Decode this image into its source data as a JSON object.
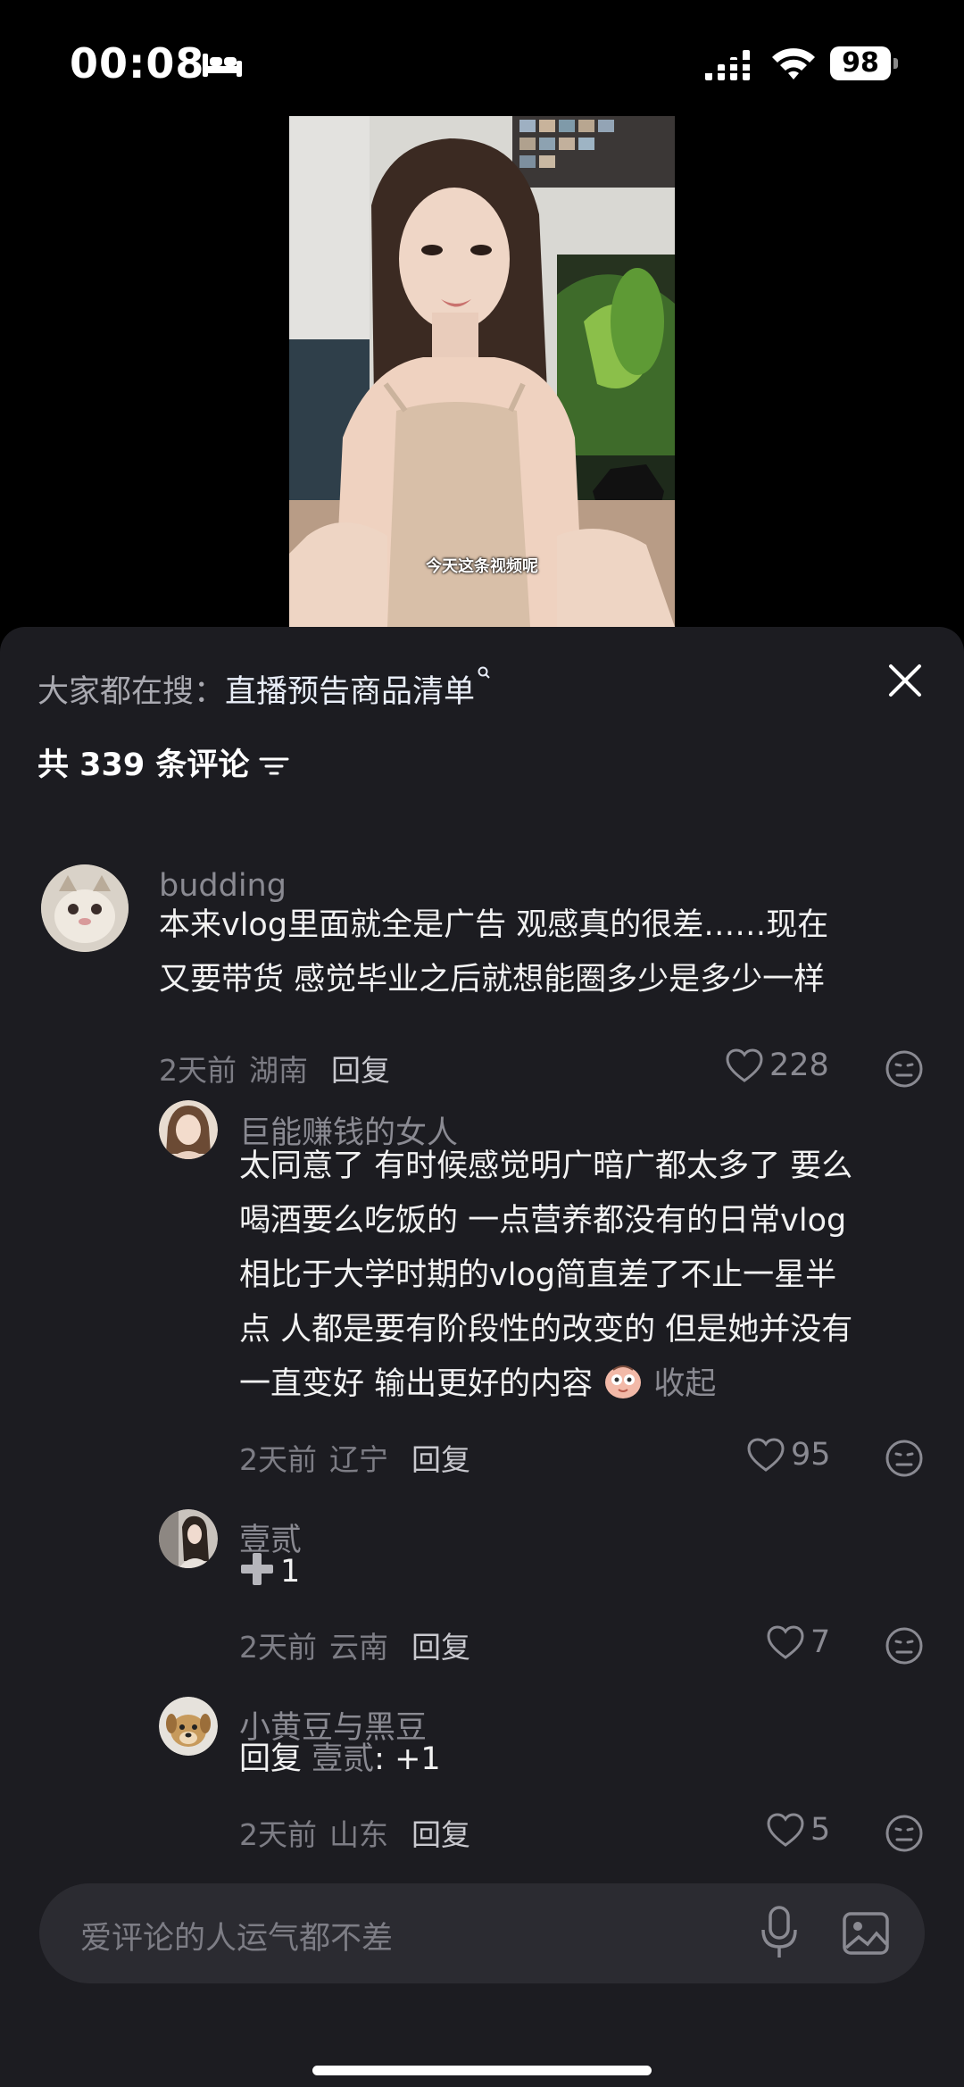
{
  "status_bar": {
    "time": "00:08",
    "battery": "98"
  },
  "video": {
    "subtitle": "今天这条视频呢"
  },
  "sheet": {
    "search_prefix": "大家都在搜：",
    "search_keyword": "直播预告商品清单",
    "count_text": "共 339 条评论"
  },
  "comments": [
    {
      "user": "budding",
      "lines": [
        "本来vlog里面就全是广告 观感真的很差……现在",
        "又要带货 感觉毕业之后就想能圈多少是多少一样"
      ],
      "time": "2天前",
      "location": "湖南",
      "reply_label": "回复",
      "likes": "228"
    },
    {
      "user": "巨能赚钱的女人",
      "lines": [
        "太同意了 有时候感觉明广暗广都太多了 要么",
        "喝酒要么吃饭的 一点营养都没有的日常vlog",
        "相比于大学时期的vlog简直差了不止一星半",
        "点 人都是要有阶段性的改变的 但是她并没有",
        "一直变好 输出更好的内容"
      ],
      "collapse_label": "收起",
      "time": "2天前",
      "location": "辽宁",
      "reply_label": "回复",
      "likes": "95"
    },
    {
      "user": "壹贰",
      "text": "1",
      "time": "2天前",
      "location": "云南",
      "reply_label": "回复",
      "likes": "7"
    },
    {
      "user": "小黄豆与黑豆",
      "reply_prefix": "回复",
      "reply_to": "壹贰",
      "reply_text": ": +1",
      "time": "2天前",
      "location": "山东",
      "reply_label": "回复",
      "likes": "5"
    }
  ],
  "input": {
    "placeholder": "爱评论的人运气都不差"
  },
  "icons": [
    "bed-icon",
    "signal-icon",
    "wifi-icon",
    "close-icon",
    "filter-icon",
    "heart-icon",
    "emoji-icon",
    "mic-icon",
    "image-icon",
    "plus-icon",
    "search-icon"
  ]
}
